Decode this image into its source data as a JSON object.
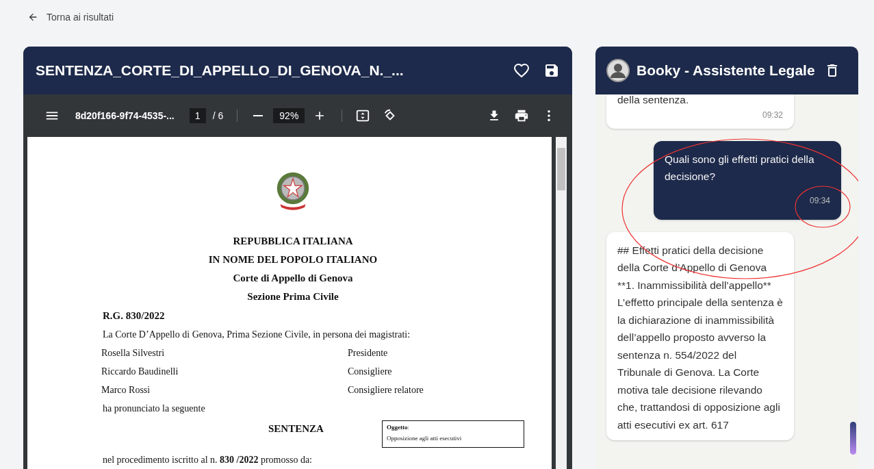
{
  "back_link": {
    "label": "Torna ai risultati"
  },
  "document_panel": {
    "title": "SENTENZA_CORTE_DI_APPELLO_DI_GENOVA_N._...",
    "favorite": false
  },
  "pdf_toolbar": {
    "filename": "8d20f166-9f74-4535-...",
    "page": "1",
    "page_of": "/ 6",
    "zoom": "92%"
  },
  "pdf_page": {
    "headings": [
      "REPUBBLICA ITALIANA",
      "IN NOME DEL POPOLO ITALIANO",
      "Corte di Appello di Genova",
      "Sezione Prima Civile"
    ],
    "rg": "R.G. 830/2022",
    "intro": "La Corte D’Appello di Genova, Prima Sezione Civile, in persona dei magistrati:",
    "magistrates": [
      {
        "name": "Rosella Silvestri",
        "role": "Presidente"
      },
      {
        "name": "Riccardo Baudinelli",
        "role": "Consigliere"
      },
      {
        "name": "Marco Rossi",
        "role": "Consigliere relatore"
      }
    ],
    "pronounced": "ha pronunciato la seguente",
    "title": "SENTENZA",
    "subject": {
      "label": "Oggetto",
      "colon": ":",
      "text": "Opposizione agli atti esecutivi"
    },
    "proceeding": "nel procedimento iscritto al n. **830 /2022** promosso da:"
  },
  "chat": {
    "title": "Booky - Assistente Legale",
    "messages": [
      {
        "kind": "bot",
        "text": "della sentenza.",
        "time": "09:32"
      },
      {
        "kind": "user",
        "text": "Quali sono gli effetti pratici della decisione?",
        "time": "09:34"
      },
      {
        "kind": "bot",
        "text": "## Effetti pratici della decisione della Corte d’Appello di Genova **1. Inammissibilità dell’appello** L’effetto principale della sentenza è la dichiarazione di inammissibilità dell’appello proposto avverso la sentenza n. 554/2022 del Tribunale di Genova. La Corte motiva tale decisione rilevando che, trattandosi di opposizione agli atti esecutivi ex art. 617"
      }
    ]
  }
}
